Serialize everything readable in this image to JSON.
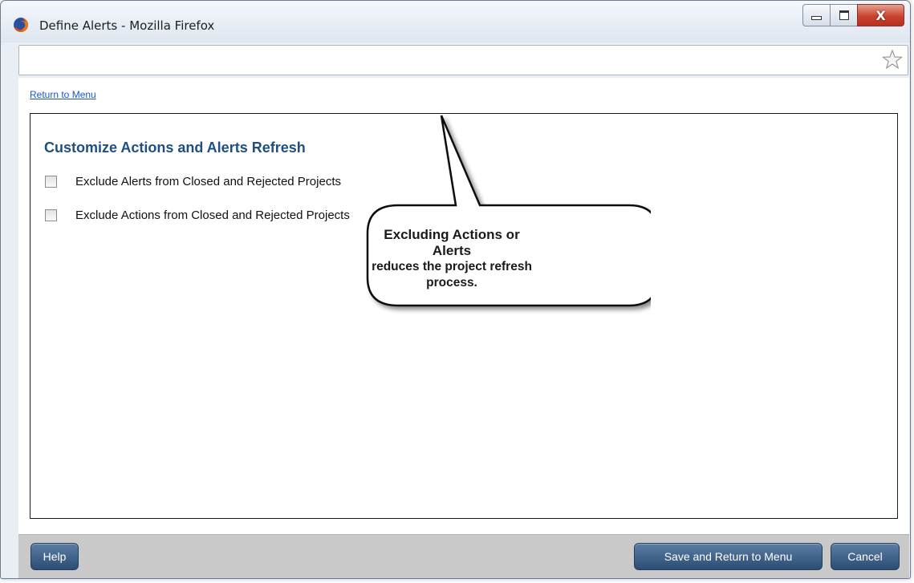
{
  "window": {
    "title": "Define Alerts - Mozilla Firefox",
    "controls": {
      "minimize": "minimize-icon",
      "maximize": "maximize-icon",
      "close_label": "X"
    }
  },
  "address_bar": {
    "value": "",
    "bookmark_icon": "star-icon"
  },
  "page": {
    "return_link": "Return to Menu",
    "section_title": "Customize Actions and Alerts Refresh",
    "options": [
      {
        "label": "Exclude Alerts from Closed and Rejected Projects",
        "checked": false
      },
      {
        "label": "Exclude Actions from Closed and Rejected Projects",
        "checked": false
      }
    ]
  },
  "callout": {
    "line1": "Excluding Actions or Alerts",
    "line2": "reduces the project refresh",
    "line3": "process."
  },
  "footer": {
    "help_label": "Help",
    "save_label": "Save and Return to Menu",
    "cancel_label": "Cancel"
  },
  "colors": {
    "section_title": "#1f4f82",
    "link": "#1a56c8",
    "button_bg": "#3a5b82",
    "footer_bg": "#c9c9c9"
  }
}
